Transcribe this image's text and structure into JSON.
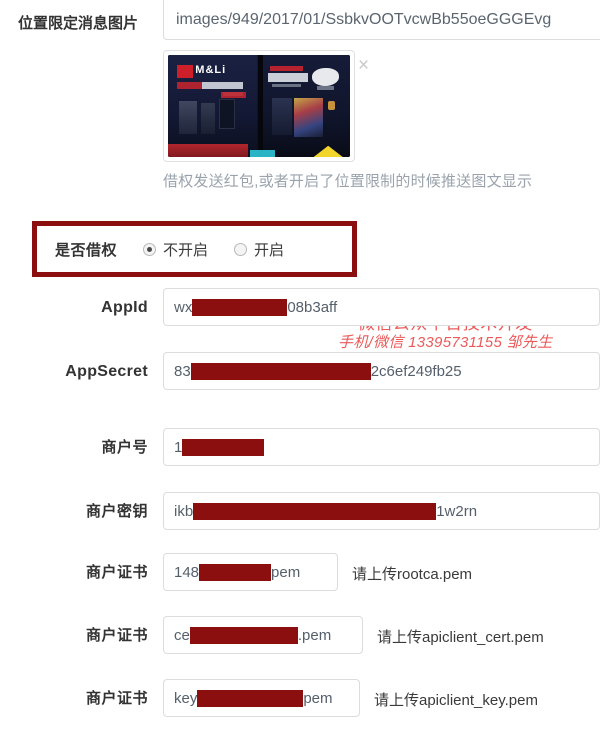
{
  "colors": {
    "redact": "#8b0f0f",
    "highlight_box": "#8b0f0f",
    "watermark": "#ea5a5a",
    "field_border": "#dcdcdc",
    "label_text": "#333333",
    "hint_text": "#9aa3ad"
  },
  "image_field": {
    "label": "位置限定消息图片",
    "url_value": "images/949/2017/01/SsbkvOOTvcwBb55oeGGGEvg",
    "close_icon": "close-icon",
    "thumbnail_alt": "AM&Li storefront night photo",
    "thumbnail_sign_text": "M&Li",
    "hint": "借权发送红包,或者开启了位置限制的时候推送图文显示"
  },
  "borrow_permission": {
    "label": "是否借权",
    "options": [
      {
        "label": "不开启",
        "selected": true
      },
      {
        "label": "开启",
        "selected": false
      }
    ]
  },
  "watermark": {
    "line1": "微信公众平台技术开发",
    "line2": "手机/微信 13395731155 邹先生"
  },
  "fields": [
    {
      "label": "AppId",
      "latin": true,
      "prefix": "wx",
      "redact_width": 95,
      "suffix": "08b3aff",
      "hint": ""
    },
    {
      "label": "AppSecret",
      "latin": true,
      "prefix": "83",
      "redact_width": 180,
      "suffix": "2c6ef249fb25",
      "hint": ""
    },
    {
      "label": "商户号",
      "latin": false,
      "prefix": "1",
      "redact_width": 82,
      "suffix": "",
      "hint": ""
    },
    {
      "label": "商户密钥",
      "latin": false,
      "prefix": "ikb",
      "redact_width": 243,
      "suffix": "1w2rn",
      "hint": ""
    },
    {
      "label": "商户证书",
      "latin": false,
      "prefix": "148",
      "redact_width": 72,
      "suffix": "pem",
      "hint": "请上传rootca.pem"
    },
    {
      "label": "商户证书",
      "latin": false,
      "prefix": "ce",
      "redact_width": 108,
      "suffix": ".pem",
      "hint": "请上传apiclient_cert.pem"
    },
    {
      "label": "商户证书",
      "latin": false,
      "prefix": "key",
      "redact_width": 106,
      "suffix": "pem",
      "hint": "请上传apiclient_key.pem"
    }
  ]
}
